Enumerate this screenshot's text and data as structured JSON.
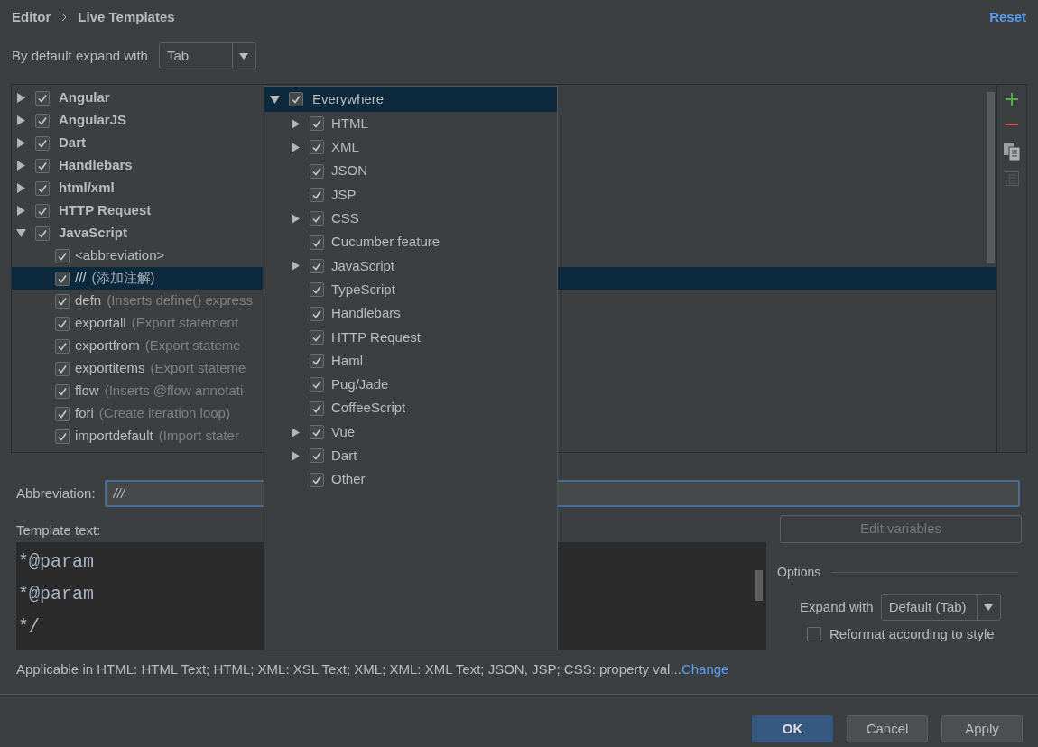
{
  "breadcrumb": [
    {
      "label": "Editor"
    },
    {
      "label": "Live Templates"
    }
  ],
  "reset_link": "Reset",
  "expand_default": {
    "label": "By default expand with",
    "value": "Tab"
  },
  "template_groups": [
    {
      "name": "Angular",
      "expanded": false,
      "checked": true
    },
    {
      "name": "AngularJS",
      "expanded": false,
      "checked": true
    },
    {
      "name": "Dart",
      "expanded": false,
      "checked": true
    },
    {
      "name": "Handlebars",
      "expanded": false,
      "checked": true
    },
    {
      "name": "html/xml",
      "expanded": false,
      "checked": true
    },
    {
      "name": "HTTP Request",
      "expanded": false,
      "checked": true
    },
    {
      "name": "JavaScript",
      "expanded": true,
      "checked": true,
      "children": [
        {
          "abbreviation": "<abbreviation>",
          "checked": true,
          "selected": false
        },
        {
          "abbreviation": "///",
          "description": "(添加注解)",
          "checked": true,
          "selected": true
        },
        {
          "abbreviation": "defn",
          "description": "(Inserts define() express",
          "checked": true,
          "selected": false
        },
        {
          "abbreviation": "exportall",
          "description": "(Export statement",
          "checked": true,
          "selected": false
        },
        {
          "abbreviation": "exportfrom",
          "description": "(Export stateme",
          "checked": true,
          "selected": false
        },
        {
          "abbreviation": "exportitems",
          "description": "(Export stateme",
          "checked": true,
          "selected": false
        },
        {
          "abbreviation": "flow",
          "description": "(Inserts @flow annotati",
          "checked": true,
          "selected": false
        },
        {
          "abbreviation": "fori",
          "description": "(Create iteration loop)",
          "checked": true,
          "selected": false
        },
        {
          "abbreviation": "importdefault",
          "description": "(Import stater",
          "checked": true,
          "selected": false
        }
      ]
    }
  ],
  "context_popup": {
    "root": {
      "label": "Everywhere",
      "expanded": true,
      "checked": true,
      "selected": true
    },
    "children": [
      {
        "label": "HTML",
        "expandable": true,
        "checked": true
      },
      {
        "label": "XML",
        "expandable": true,
        "checked": true
      },
      {
        "label": "JSON",
        "expandable": false,
        "checked": true
      },
      {
        "label": "JSP",
        "expandable": false,
        "checked": true
      },
      {
        "label": "CSS",
        "expandable": true,
        "checked": true
      },
      {
        "label": "Cucumber feature",
        "expandable": false,
        "checked": true
      },
      {
        "label": "JavaScript",
        "expandable": true,
        "checked": true
      },
      {
        "label": "TypeScript",
        "expandable": false,
        "checked": true
      },
      {
        "label": "Handlebars",
        "expandable": false,
        "checked": true
      },
      {
        "label": "HTTP Request",
        "expandable": false,
        "checked": true
      },
      {
        "label": "Haml",
        "expandable": false,
        "checked": true
      },
      {
        "label": "Pug/Jade",
        "expandable": false,
        "checked": true
      },
      {
        "label": "CoffeeScript",
        "expandable": false,
        "checked": true
      },
      {
        "label": "Vue",
        "expandable": true,
        "checked": true
      },
      {
        "label": "Dart",
        "expandable": true,
        "checked": true
      },
      {
        "label": "Other",
        "expandable": false,
        "checked": true
      }
    ]
  },
  "abbreviation": {
    "label": "Abbreviation:",
    "value": "///"
  },
  "template_text": {
    "label": "Template text:",
    "lines": [
      "*@param",
      "*@param",
      "*/"
    ]
  },
  "edit_variables_button": {
    "label": "Edit variables",
    "disabled": true
  },
  "options": {
    "title": "Options",
    "expand_with": {
      "label": "Expand with",
      "value": "Default (Tab)"
    },
    "reformat": {
      "label": "Reformat according to style",
      "checked": false
    }
  },
  "applicable": {
    "text": "Applicable in HTML: HTML Text; HTML; XML: XSL Text; XML; XML: XML Text; JSON, JSP; CSS: property val...",
    "link": "Change"
  },
  "buttons": [
    {
      "label": "OK",
      "primary": true
    },
    {
      "label": "Cancel",
      "primary": false
    },
    {
      "label": "Apply",
      "primary": false
    }
  ]
}
